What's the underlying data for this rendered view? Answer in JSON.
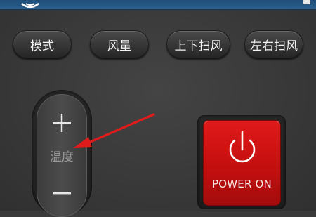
{
  "buttons": {
    "mode": "模式",
    "fan_speed": "风量",
    "swing_vertical": "上下扫风",
    "swing_horizontal": "左右扫风"
  },
  "temperature": {
    "label": "温度",
    "increase_icon": "plus-icon",
    "decrease_icon": "minus-icon"
  },
  "power": {
    "label": "POWER ON",
    "icon": "power-icon",
    "color": "#d21414"
  },
  "annotation": {
    "icon": "arrow-icon",
    "color": "#e01b1b"
  },
  "header": {
    "bar_color": "#2b5f8c",
    "logo_icon": "brand-logo-icon"
  }
}
